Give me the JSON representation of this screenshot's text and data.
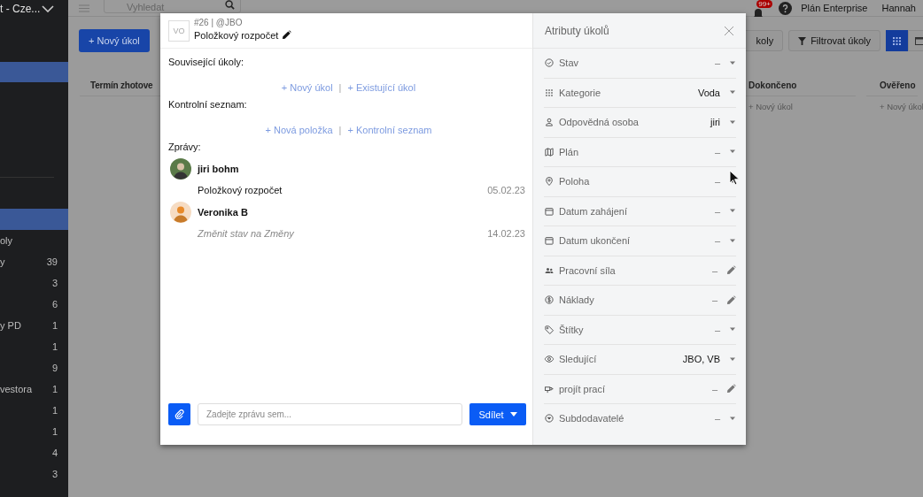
{
  "sidebar": {
    "header": "t - Cze...",
    "sections": [
      {
        "items": [
          {
            "selected": true
          }
        ]
      },
      {
        "items": [
          {
            "selected": true
          },
          {
            "label": "oly",
            "selected": false
          },
          {
            "label": "y",
            "count": "39",
            "selected": false
          },
          {
            "count": "3",
            "selected": false
          },
          {
            "count": "6",
            "selected": false
          },
          {
            "label": "y PD",
            "count": "1",
            "selected": false
          },
          {
            "count": "1",
            "selected": false
          },
          {
            "count": "9",
            "selected": false
          },
          {
            "label": "vestora",
            "count": "1",
            "selected": false
          },
          {
            "count": "1",
            "selected": false
          },
          {
            "count": "1",
            "selected": false
          },
          {
            "count": "4",
            "selected": false
          },
          {
            "count": "3",
            "selected": false
          }
        ]
      }
    ]
  },
  "top_bar": {
    "search": {
      "placeholder": "Vyhledat"
    },
    "notifications_badge": "99+",
    "plan": "Plán Enterprise",
    "user": "Hannah"
  },
  "toolbar": {
    "new_task": "+ Nový úkol",
    "buttons": [
      {
        "label": "koly",
        "kind": "plain"
      },
      {
        "label": "Filtrovat úkoly",
        "kind": "filter"
      }
    ],
    "views": [
      {
        "selected": true
      },
      {
        "selected": false
      }
    ]
  },
  "board": {
    "columns": [
      {
        "title": "Termín zhotove"
      },
      {
        "title": "Dokončeno",
        "add": "+ Nový úkol"
      },
      {
        "title": "Ověřeno",
        "add": "+ Nový úkol"
      }
    ]
  },
  "task": {
    "logo": "VO",
    "ref": "#26 | @JBO",
    "title": "Položkový rozpočet",
    "sections": [
      {
        "heading": "Související úkoly:",
        "links": [
          "+ Nový úkol",
          "+ Existující úkol"
        ],
        "separator": "|"
      },
      {
        "heading": "Kontrolní seznam:",
        "links": [
          "+ Nová položka",
          "+ Kontrolní seznam"
        ],
        "separator": "|"
      }
    ],
    "messages_heading": "Zprávy:",
    "messages": [
      {
        "author": "jiri bohm",
        "text": "Položkový rozpočet",
        "date": "05.02.23",
        "kind": "comment"
      },
      {
        "author": "Veronika B",
        "text": "Změnit stav na Změny",
        "date": "14.02.23",
        "kind": "activity"
      }
    ],
    "composer": {
      "placeholder": "Zadejte zprávu sem...",
      "send": "Sdílet"
    }
  },
  "attributes": {
    "title": "Atributy úkolů",
    "rows": [
      {
        "label": "Stav",
        "value": "–",
        "kind": "dropdown",
        "set": false
      },
      {
        "label": "Kategorie",
        "value": "Voda",
        "kind": "dropdown",
        "set": true
      },
      {
        "label": "Odpovědná osoba",
        "value": "jiri",
        "kind": "dropdown",
        "set": true
      },
      {
        "label": "Plán",
        "value": "–",
        "kind": "dropdown",
        "set": false
      },
      {
        "label": "Poloha",
        "value": "–",
        "kind": "dropdown",
        "set": false
      },
      {
        "label": "Datum zahájení",
        "value": "–",
        "kind": "dropdown",
        "set": false
      },
      {
        "label": "Datum ukončení",
        "value": "–",
        "kind": "dropdown",
        "set": false
      },
      {
        "label": "Pracovní síla",
        "value": "–",
        "kind": "edit",
        "set": false
      },
      {
        "label": "Náklady",
        "value": "–",
        "kind": "edit",
        "set": false
      },
      {
        "label": "Štítky",
        "value": "–",
        "kind": "dropdown",
        "set": false
      },
      {
        "label": "Sledující",
        "value": "JBO, VB",
        "kind": "dropdown",
        "set": true
      },
      {
        "label": "projít prací",
        "value": "–",
        "kind": "edit",
        "set": false
      },
      {
        "label": "Subdodavatelé",
        "value": "–",
        "kind": "dropdown",
        "set": false
      }
    ]
  }
}
